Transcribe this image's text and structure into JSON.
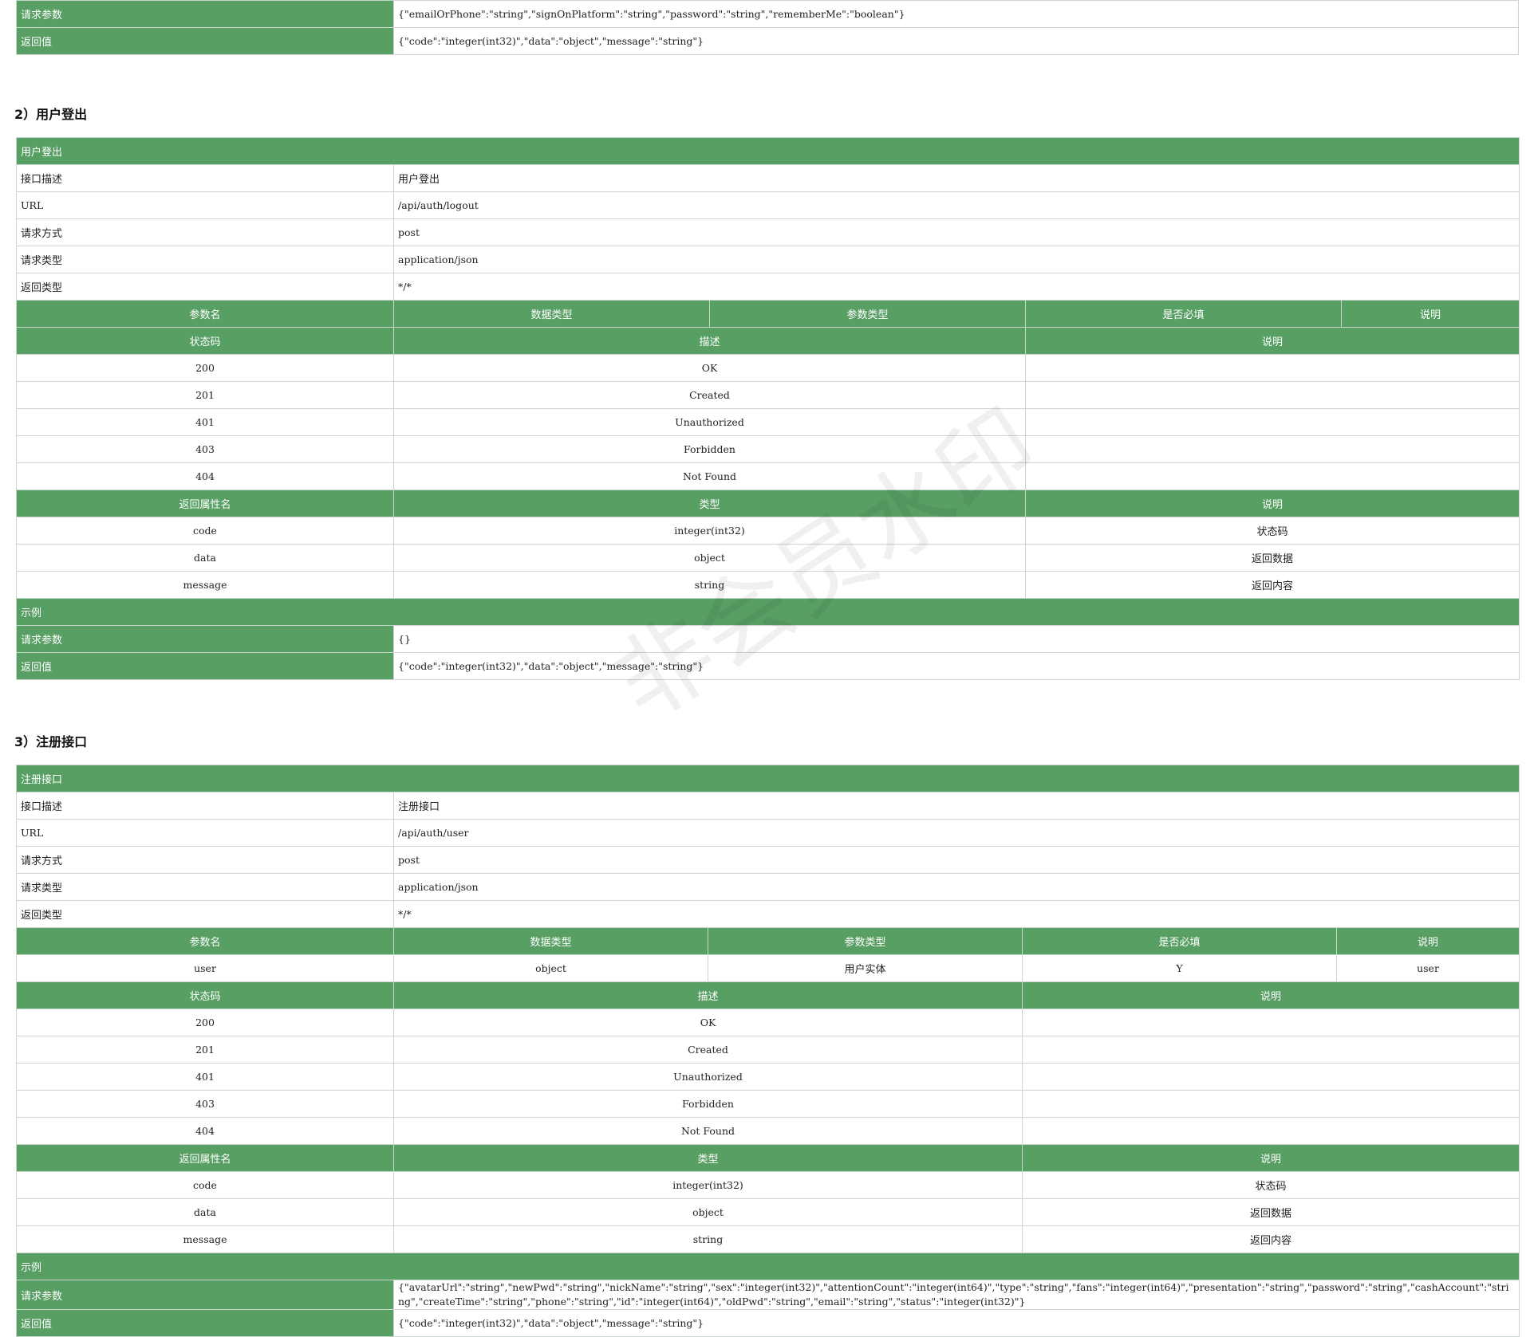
{
  "top_example": {
    "req_label": "请求参数",
    "req_value": "{\"emailOrPhone\":\"string\",\"signOnPlatform\":\"string\",\"password\":\"string\",\"rememberMe\":\"boolean\"}",
    "ret_label": "返回值",
    "ret_value": "{\"code\":\"integer(int32)\",\"data\":\"object\",\"message\":\"string\"}"
  },
  "sec2": {
    "heading": "2）用户登出",
    "title": "用户登出",
    "info": [
      {
        "k": "接口描述",
        "v": "用户登出"
      },
      {
        "k": "URL",
        "v": "/api/auth/logout"
      },
      {
        "k": "请求方式",
        "v": "post"
      },
      {
        "k": "请求类型",
        "v": "application/json"
      },
      {
        "k": "返回类型",
        "v": "*/*"
      }
    ],
    "param_headers": [
      "参数名",
      "数据类型",
      "参数类型",
      "是否必填",
      "说明"
    ],
    "status_headers": [
      "状态码",
      "描述",
      "说明"
    ],
    "status_rows": [
      {
        "code": "200",
        "desc": "OK",
        "note": ""
      },
      {
        "code": "201",
        "desc": "Created",
        "note": ""
      },
      {
        "code": "401",
        "desc": "Unauthorized",
        "note": ""
      },
      {
        "code": "403",
        "desc": "Forbidden",
        "note": ""
      },
      {
        "code": "404",
        "desc": "Not Found",
        "note": ""
      }
    ],
    "ret_headers": [
      "返回属性名",
      "类型",
      "说明"
    ],
    "ret_rows": [
      {
        "name": "code",
        "type": "integer(int32)",
        "note": "状态码"
      },
      {
        "name": "data",
        "type": "object",
        "note": "返回数据"
      },
      {
        "name": "message",
        "type": "string",
        "note": "返回内容"
      }
    ],
    "example_label": "示例",
    "req_label": "请求参数",
    "req_value": "{}",
    "ret_label": "返回值",
    "ret_value": "{\"code\":\"integer(int32)\",\"data\":\"object\",\"message\":\"string\"}"
  },
  "sec3": {
    "heading": "3）注册接口",
    "title": "注册接口",
    "info": [
      {
        "k": "接口描述",
        "v": "注册接口"
      },
      {
        "k": "URL",
        "v": "/api/auth/user"
      },
      {
        "k": "请求方式",
        "v": "post"
      },
      {
        "k": "请求类型",
        "v": "application/json"
      },
      {
        "k": "返回类型",
        "v": "*/*"
      }
    ],
    "param_headers": [
      "参数名",
      "数据类型",
      "参数类型",
      "是否必填",
      "说明"
    ],
    "param_row": {
      "name": "user",
      "dtype": "object",
      "ptype": "用户实体",
      "required": "Y",
      "note": "user"
    },
    "status_headers": [
      "状态码",
      "描述",
      "说明"
    ],
    "status_rows": [
      {
        "code": "200",
        "desc": "OK",
        "note": ""
      },
      {
        "code": "201",
        "desc": "Created",
        "note": ""
      },
      {
        "code": "401",
        "desc": "Unauthorized",
        "note": ""
      },
      {
        "code": "403",
        "desc": "Forbidden",
        "note": ""
      },
      {
        "code": "404",
        "desc": "Not Found",
        "note": ""
      }
    ],
    "ret_headers": [
      "返回属性名",
      "类型",
      "说明"
    ],
    "ret_rows": [
      {
        "name": "code",
        "type": "integer(int32)",
        "note": "状态码"
      },
      {
        "name": "data",
        "type": "object",
        "note": "返回数据"
      },
      {
        "name": "message",
        "type": "string",
        "note": "返回内容"
      }
    ],
    "example_label": "示例",
    "req_label": "请求参数",
    "req_value": "{\"avatarUrl\":\"string\",\"newPwd\":\"string\",\"nickName\":\"string\",\"sex\":\"integer(int32)\",\"attentionCount\":\"integer(int64)\",\"type\":\"string\",\"fans\":\"integer(int64)\",\"presentation\":\"string\",\"password\":\"string\",\"cashAccount\":\"string\",\"createTime\":\"string\",\"phone\":\"string\",\"id\":\"integer(int64)\",\"oldPwd\":\"string\",\"email\":\"string\",\"status\":\"integer(int32)\"}",
    "ret_label": "返回值",
    "ret_value": "{\"code\":\"integer(int32)\",\"data\":\"object\",\"message\":\"string\"}"
  },
  "watermark": "非会员水印"
}
